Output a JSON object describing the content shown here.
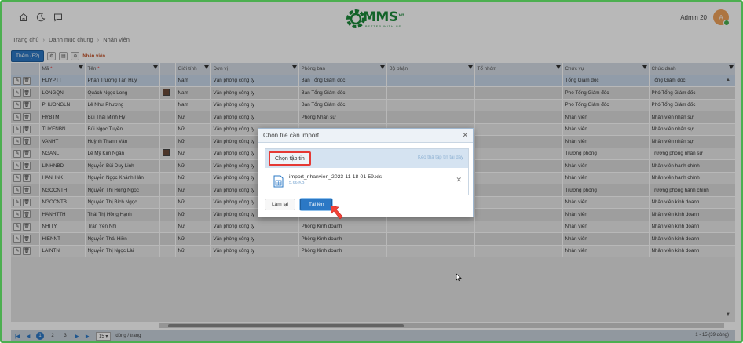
{
  "header": {
    "brand": "MMS",
    "brand_suffix": ".vn",
    "tagline": "BETTER WITH US",
    "user_name": "Admin 20",
    "avatar_letter": "A"
  },
  "breadcrumb": [
    "Trang chủ",
    "Danh mục chung",
    "Nhân viên"
  ],
  "toolbar": {
    "add_label": "Thêm (F2)",
    "section_label": "Nhân viên"
  },
  "grid": {
    "columns": [
      "Mã",
      "Tên",
      "Giới tính",
      "Đơn vị",
      "Phòng ban",
      "Bộ phận",
      "Tổ nhóm",
      "Chức vụ",
      "Chức danh"
    ],
    "rows": [
      [
        "HUYPTT",
        "Phan Trương Tấn Huy",
        "",
        "Nam",
        "Văn phòng công ty",
        "Ban Tổng Giám đốc",
        "",
        "",
        "Tổng Giám đốc",
        "Tổng Giám đốc"
      ],
      [
        "LONGQN",
        "Quách Ngọc Long",
        "img",
        "Nam",
        "Văn phòng công ty",
        "Ban Tổng Giám đốc",
        "",
        "",
        "Phó Tổng Giám đốc",
        "Phó Tổng Giám đốc"
      ],
      [
        "PHUONGLN",
        "Lê Như Phương",
        "",
        "Nam",
        "Văn phòng công ty",
        "Ban Tổng Giám đốc",
        "",
        "",
        "Phó Tổng Giám đốc",
        "Phó Tổng Giám đốc"
      ],
      [
        "HYBTM",
        "Bùi Thái Minh Hy",
        "",
        "Nữ",
        "Văn phòng công ty",
        "Phòng Nhân sự",
        "",
        "",
        "Nhân viên",
        "Nhân viên nhân sự"
      ],
      [
        "TUYENBN",
        "Bùi Ngọc Tuyền",
        "",
        "Nữ",
        "Văn phòng công ty",
        "",
        "",
        "",
        "Nhân viên",
        "Nhân viên nhân sự"
      ],
      [
        "VANHT",
        "Huỳnh Thanh Vân",
        "",
        "Nữ",
        "Văn phòng công ty",
        "",
        "",
        "",
        "Nhân viên",
        "Nhân viên nhân sự"
      ],
      [
        "NGANL",
        "Lê Mỹ Kim Ngân",
        "img",
        "Nữ",
        "Văn phòng công ty",
        "",
        "",
        "",
        "Trưởng phòng",
        "Trưởng phòng nhân sự"
      ],
      [
        "LINHNBD",
        "Nguyễn Bùi Duy Linh",
        "",
        "Nữ",
        "Văn phòng công ty",
        "",
        "",
        "",
        "Nhân viên",
        "Nhân viên hành chính"
      ],
      [
        "HANHNK",
        "Nguyễn Ngọc Khánh Hân",
        "",
        "Nữ",
        "Văn phòng công ty",
        "",
        "",
        "",
        "Nhân viên",
        "Nhân viên hành chính"
      ],
      [
        "NGOCNTH",
        "Nguyễn Thị Hồng Ngọc",
        "",
        "Nữ",
        "Văn phòng công ty",
        "",
        "",
        "",
        "Trưởng phòng",
        "Trưởng phòng hành chính"
      ],
      [
        "NGOCNTB",
        "Nguyễn Thị Bích Ngọc",
        "",
        "Nữ",
        "Văn phòng công ty",
        "",
        "",
        "",
        "Nhân viên",
        "Nhân viên kinh doanh"
      ],
      [
        "HANHTTH",
        "Thái Thị Hồng Hạnh",
        "",
        "Nữ",
        "Văn phòng công ty",
        "",
        "",
        "",
        "Nhân viên",
        "Nhân viên kinh doanh"
      ],
      [
        "NHITY",
        "Trần Yến Nhi",
        "",
        "Nữ",
        "Văn phòng công ty",
        "Phòng Kinh doanh",
        "",
        "",
        "Nhân viên",
        "Nhân viên kinh doanh"
      ],
      [
        "HIENNT",
        "Nguyễn Thái Hiền",
        "",
        "Nữ",
        "Văn phòng công ty",
        "Phòng Kinh doanh",
        "",
        "",
        "Nhân viên",
        "Nhân viên kinh doanh"
      ],
      [
        "LAINTN",
        "Nguyễn Thị Ngọc Lài",
        "",
        "Nữ",
        "Văn phòng công ty",
        "Phòng Kinh doanh",
        "",
        "",
        "Nhân viên",
        "Nhân viên kinh doanh"
      ]
    ]
  },
  "pager": {
    "pages": [
      "1",
      "2",
      "3"
    ],
    "active_page": "1",
    "page_size": "15",
    "page_size_suffix": "dòng / trang",
    "info": "1 - 15 (39 dòng)"
  },
  "dialog": {
    "title": "Chọn file cần import",
    "pick_label": "Chọn tập tin",
    "drop_hint": "Kéo thả tập tin tại đây",
    "file_name": "import_nhanvien_2023-11-18-01-59.xls",
    "file_size": "5.66 KB",
    "reset_label": "Làm lại",
    "upload_label": "Tải lên"
  }
}
